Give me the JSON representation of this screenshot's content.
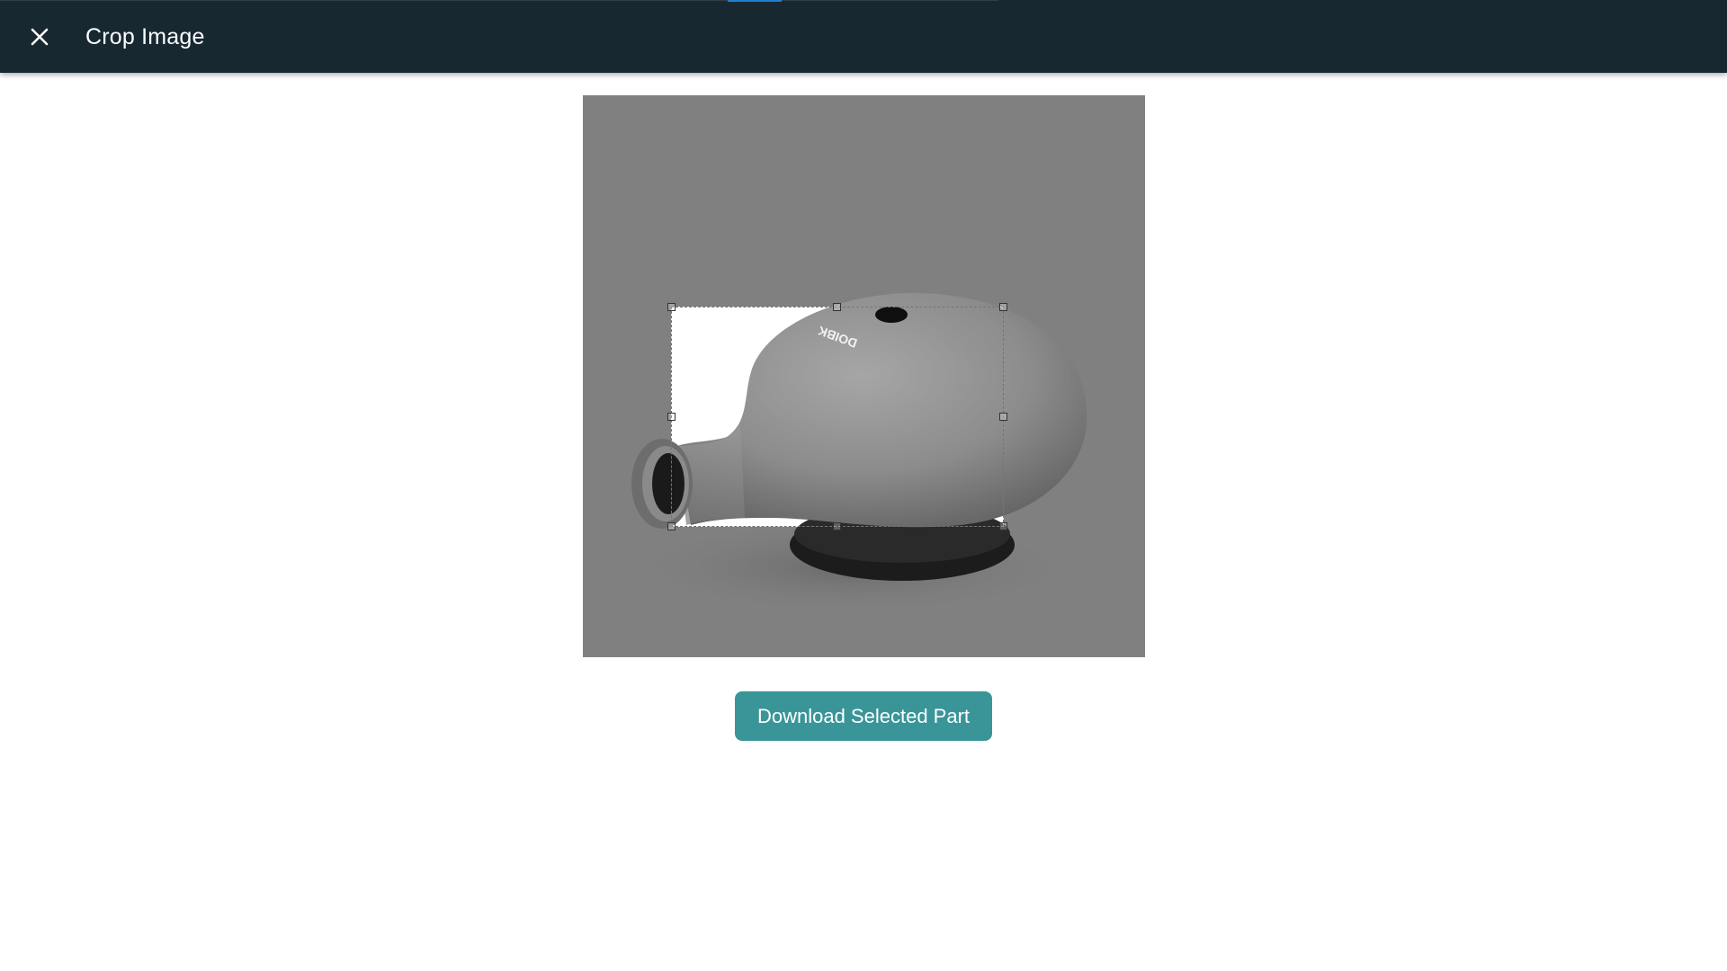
{
  "header": {
    "title": "Crop Image",
    "close_icon": "close-icon",
    "background": "#172831"
  },
  "image": {
    "product_logo_text": "DOIBK",
    "palette": "grayscale"
  },
  "actions": {
    "download_label": "Download Selected Part",
    "accent": "#3a9599"
  }
}
